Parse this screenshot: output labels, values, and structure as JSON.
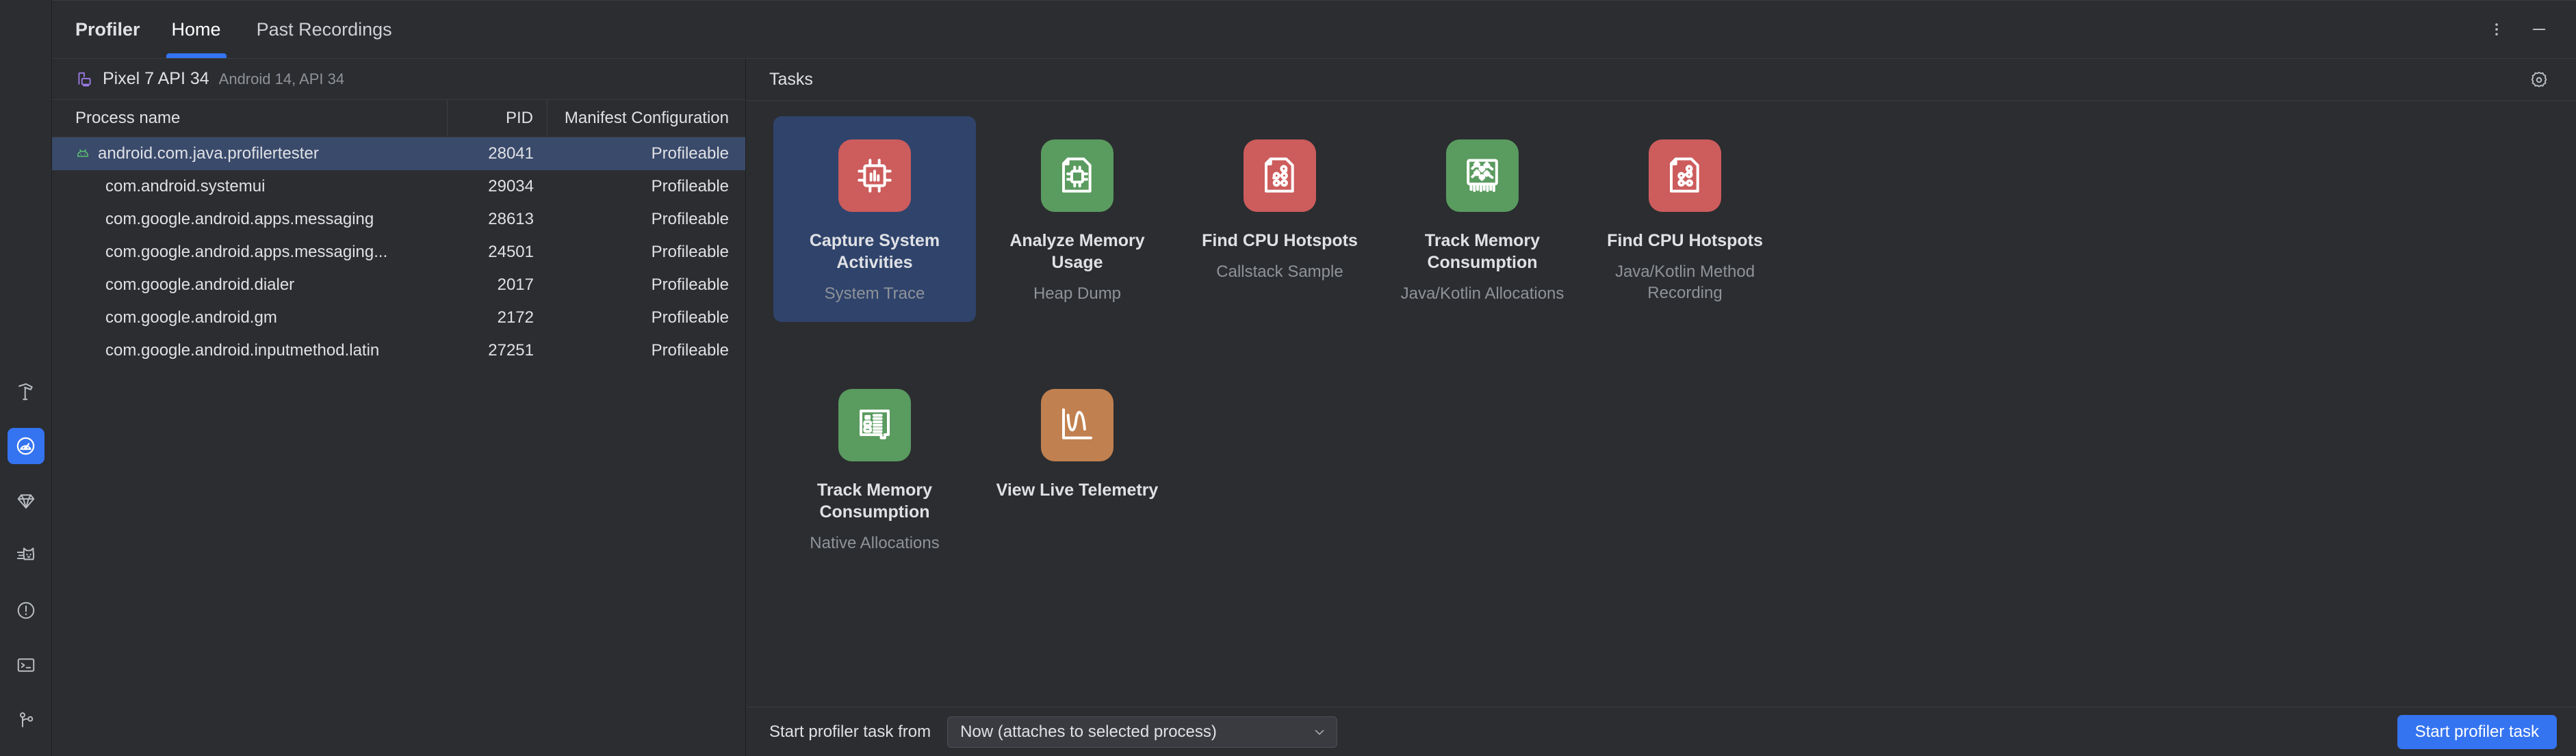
{
  "colors": {
    "accent_blue": "#3574f0",
    "selection_row": "#3a4a6b",
    "selected_card": "#2f436b",
    "panel_bg": "#2b2d30",
    "icon_red": "#cd5c5c",
    "icon_green": "#5a9b5f",
    "icon_orange": "#c1804f",
    "android_green": "#5cc271",
    "device_purple": "#9d7ce8"
  },
  "sidebar": {
    "items": [
      {
        "name": "build-hammer-icon",
        "label": "Build",
        "active": false
      },
      {
        "name": "profiler-gauge-icon",
        "label": "Profiler",
        "active": true
      },
      {
        "name": "gradle-gem-icon",
        "label": "Gradle",
        "active": false
      },
      {
        "name": "logcat-cat-icon",
        "label": "Logcat",
        "active": false
      },
      {
        "name": "problems-warning-icon",
        "label": "Problems",
        "active": false
      },
      {
        "name": "terminal-icon",
        "label": "Terminal",
        "active": false
      },
      {
        "name": "version-control-branch-icon",
        "label": "Version Control",
        "active": false
      }
    ]
  },
  "header": {
    "title": "Profiler",
    "tabs": [
      {
        "label": "Home",
        "active": true
      },
      {
        "label": "Past Recordings",
        "active": false
      }
    ],
    "more_options_icon": "vertical-ellipsis-icon",
    "minimize_icon": "minimize-icon"
  },
  "device": {
    "icon": "device-phone-icon",
    "name": "Pixel 7 API 34",
    "details": "Android 14, API 34"
  },
  "process_table": {
    "columns": [
      "Process name",
      "PID",
      "Manifest Configuration"
    ],
    "rows": [
      {
        "name": "android.com.java.profilertester",
        "pid": "28041",
        "config": "Profileable",
        "selected": true,
        "icon": "android-robot-icon"
      },
      {
        "name": "com.android.systemui",
        "pid": "29034",
        "config": "Profileable",
        "selected": false,
        "icon": ""
      },
      {
        "name": "com.google.android.apps.messaging",
        "pid": "28613",
        "config": "Profileable",
        "selected": false,
        "icon": ""
      },
      {
        "name": "com.google.android.apps.messaging...",
        "pid": "24501",
        "config": "Profileable",
        "selected": false,
        "icon": ""
      },
      {
        "name": "com.google.android.dialer",
        "pid": "2017",
        "config": "Profileable",
        "selected": false,
        "icon": ""
      },
      {
        "name": "com.google.android.gm",
        "pid": "2172",
        "config": "Profileable",
        "selected": false,
        "icon": ""
      },
      {
        "name": "com.google.android.inputmethod.latin",
        "pid": "27251",
        "config": "Profileable",
        "selected": false,
        "icon": ""
      }
    ]
  },
  "tasks": {
    "panel_title": "Tasks",
    "settings_icon": "gear-icon",
    "cards": [
      {
        "title": "Capture System Activities",
        "subtitle": "System Trace",
        "icon": "cpu-chip-chart-icon",
        "icon_color": "#cd5c5c",
        "selected": true
      },
      {
        "title": "Analyze Memory Usage",
        "subtitle": "Heap Dump",
        "icon": "document-chip-icon",
        "icon_color": "#5a9b5f",
        "selected": false
      },
      {
        "title": "Find CPU Hotspots",
        "subtitle": "Callstack Sample",
        "icon": "document-nodes-icon",
        "icon_color": "#cd5c5c",
        "selected": false
      },
      {
        "title": "Track Memory Consumption",
        "subtitle": "Java/Kotlin Allocations",
        "icon": "chip-graph-icon",
        "icon_color": "#5a9b5f",
        "selected": false
      },
      {
        "title": "Find CPU Hotspots",
        "subtitle": "Java/Kotlin Method Recording",
        "icon": "document-callgraph-icon",
        "icon_color": "#cd5c5c",
        "selected": false
      }
    ],
    "cards_row2": [
      {
        "title": "Track Memory Consumption",
        "subtitle": "Native Allocations",
        "icon": "ram-module-icon",
        "icon_color": "#5a9b5f",
        "selected": false
      },
      {
        "title": "View Live Telemetry",
        "subtitle": "",
        "icon": "line-chart-icon",
        "icon_color": "#c1804f",
        "selected": false
      }
    ]
  },
  "bottom_bar": {
    "label": "Start profiler task from",
    "dropdown_value": "Now (attaches to selected process)",
    "dropdown_icon": "chevron-down-icon",
    "start_button": "Start profiler task"
  }
}
